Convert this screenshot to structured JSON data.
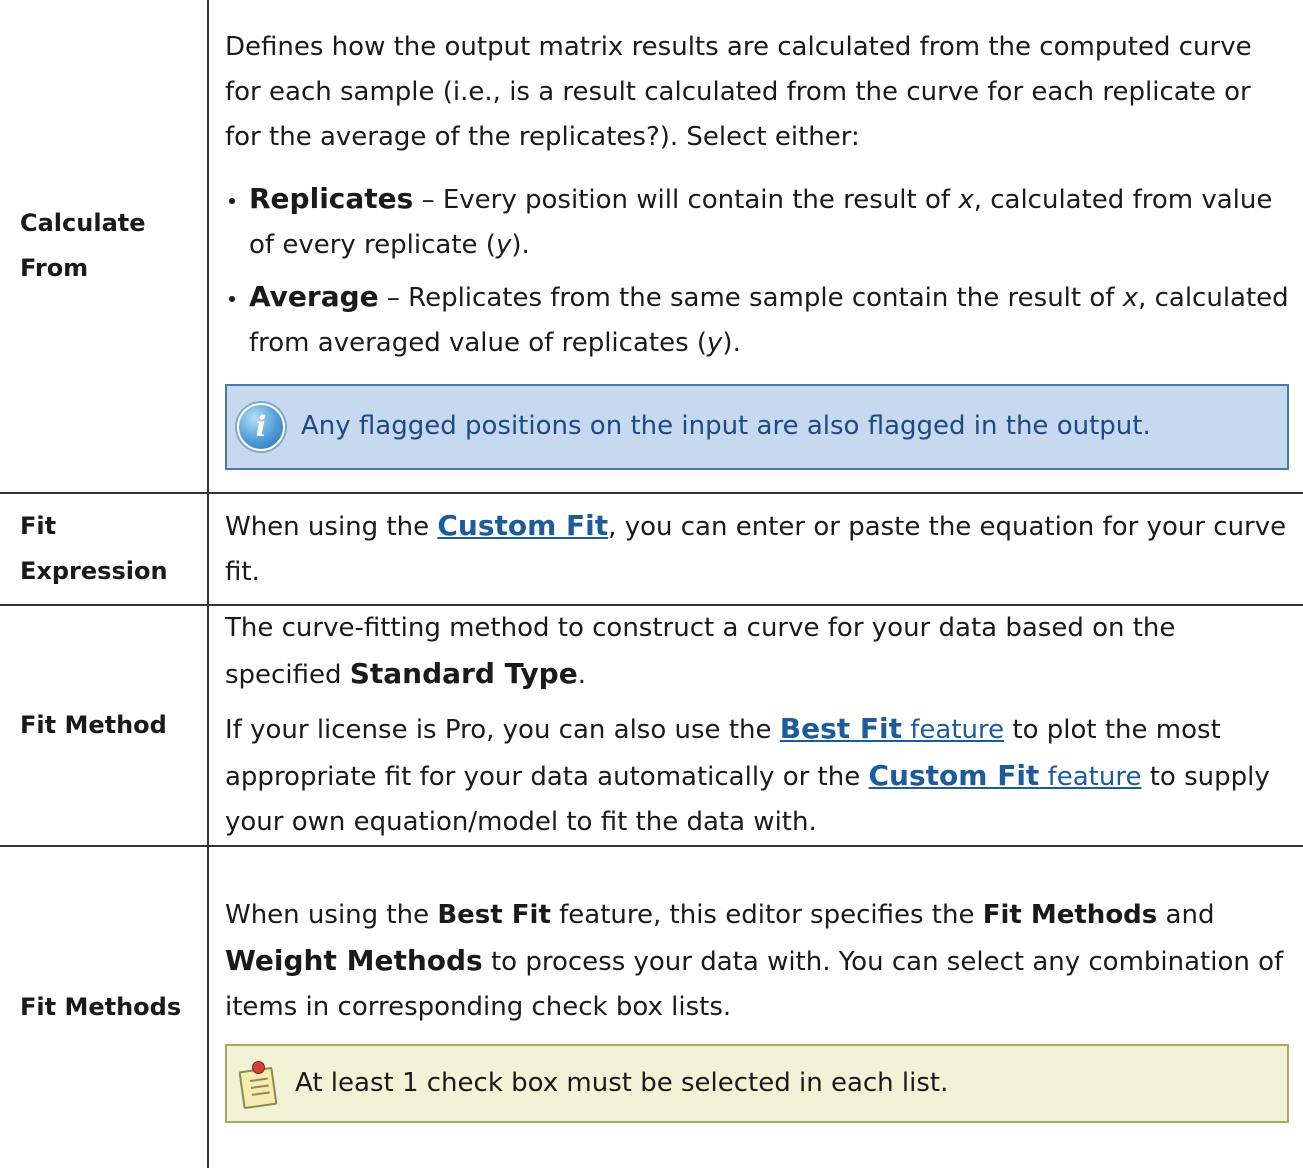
{
  "rows": {
    "calculate_from": {
      "term": "Calculate From",
      "intro": "Defines how the output matrix results are calculated from the computed curve for each sample (i.e., is a result calculated from the curve for each replicate or for the average of the replicates?). Select either:",
      "bullets": [
        {
          "title": "Replicates",
          "text_a": " – Every position will contain the result of ",
          "var_x": "x",
          "text_b": ", calculated from value of every replicate (",
          "var_y": "y",
          "text_c": ")."
        },
        {
          "title": "Average",
          "text_a": " – Replicates from the same sample contain the result of ",
          "var_x": "x",
          "text_b": ", calculated from averaged value of replicates (",
          "var_y": "y",
          "text_c": ")."
        }
      ],
      "info_note": "Any flagged positions on the input are also flagged in the output."
    },
    "fit_expression": {
      "term": "Fit Expression",
      "text_a": "When using the ",
      "link": "Custom Fit",
      "text_b": ", you can enter or paste the equation for your curve fit."
    },
    "fit_method": {
      "term": "Fit Method",
      "p1_a": "The curve-fitting method to construct a curve for your data based on the specified ",
      "p1_strong": "Standard Type",
      "p1_b": ".",
      "p2_a": "If your license is Pro, you can also use the ",
      "link1_bold": "Best Fit",
      "link1_rest": " feature",
      "p2_b": " to plot the most appropriate fit for your data automatically or the ",
      "link2_bold": "Custom Fit",
      "link2_rest": " feature",
      "p2_c": " to supply your own equation/model to fit the data with."
    },
    "fit_methods": {
      "term": "Fit Methods",
      "t1": "When using the ",
      "s1": "Best Fit",
      "t2": " feature, this editor specifies the ",
      "s2": "Fit Methods",
      "t3": " and ",
      "s3": "Weight Methods",
      "t4": " to process your data with. You can select any combination of items in corresponding check box lists.",
      "note": "At least 1 check box must be selected in each list."
    }
  }
}
